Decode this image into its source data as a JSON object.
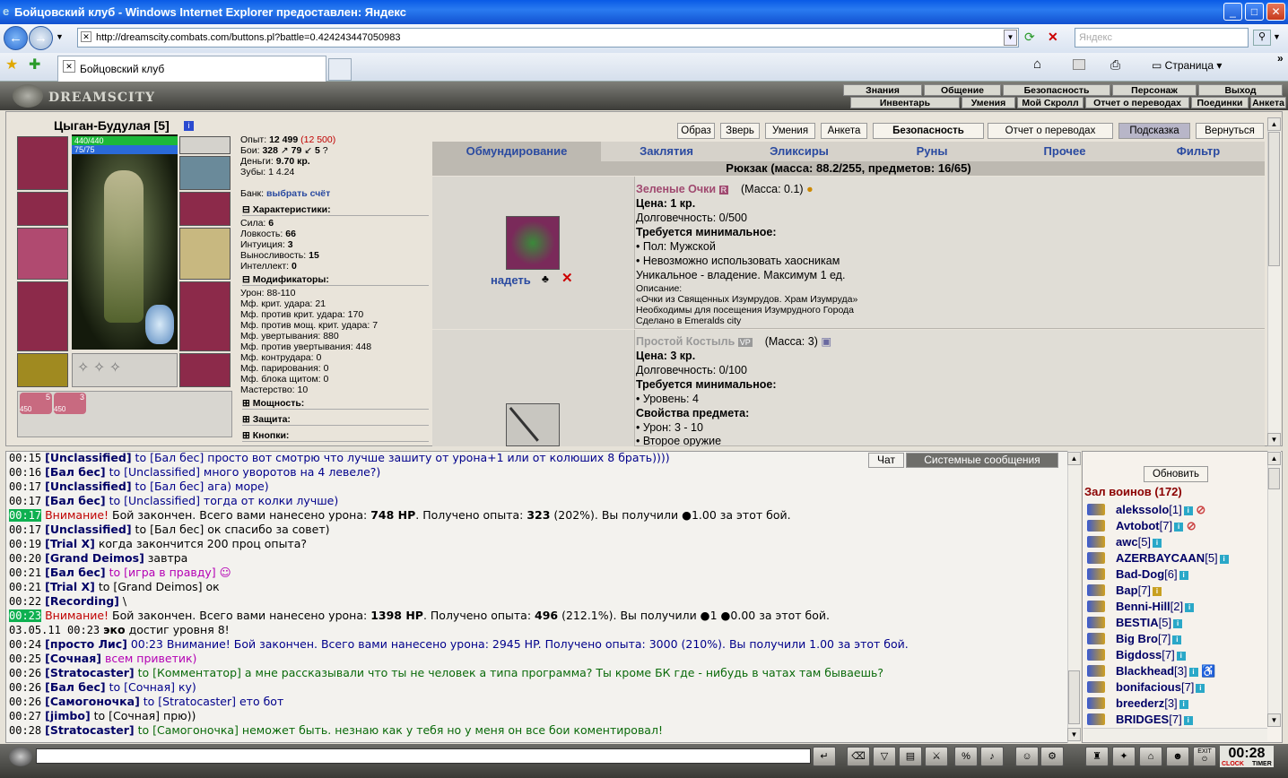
{
  "window": {
    "title": "Бойцовский клуб - Windows Internet Explorer предоставлен: Яндекс"
  },
  "browser": {
    "url": "http://dreamscity.combats.com/buttons.pl?battle=0.424243447050983",
    "search_placeholder": "Яндекс",
    "tab_title": "Бойцовский клуб",
    "page_menu": "Страница"
  },
  "game": {
    "logo": "DREAMSCITY",
    "nav_top": [
      "Знания",
      "Общение",
      "Безопасность",
      "Персонаж",
      "Выход"
    ],
    "nav_bottom": [
      "Инвентарь",
      "Умения",
      "Мой Скролл",
      "Отчет о переводах",
      "Поединки",
      "Анкета"
    ]
  },
  "character": {
    "name": "Цыган-Будулая [5]",
    "hp": "440/440",
    "mp": "75/75",
    "experience_label": "Опыт:",
    "experience": "12 499",
    "experience_next": "(12 500)",
    "fights_label": "Бои:",
    "wins": "328",
    "losses": "79",
    "draws": "5",
    "money_label": "Деньги:",
    "money": "9.70 кр.",
    "teeth_label": "Зубы:",
    "teeth": "1 4.24",
    "bank_label": "Банк:",
    "bank_link": "выбрать счёт",
    "belt_counts": [
      "5",
      "3"
    ],
    "belt_labels": [
      "450",
      "450"
    ],
    "characteristics_title": "Характеристики:",
    "stats": [
      {
        "label": "Сила:",
        "value": "6"
      },
      {
        "label": "Ловкость:",
        "value": "66"
      },
      {
        "label": "Интуиция:",
        "value": "3"
      },
      {
        "label": "Выносливость:",
        "value": "15"
      },
      {
        "label": "Интеллект:",
        "value": "0"
      }
    ],
    "modifiers_title": "Модификаторы:",
    "modifiers": [
      "Урон: 88-110",
      "Мф. крит. удара: 21",
      "Мф. против крит. удара: 170",
      "Мф. против мощ. крит. удара: 7",
      "Мф. увертывания: 880",
      "Мф. против увертывания: 448",
      "Мф. контрудара: 0",
      "Мф. парирования: 0",
      "Мф. блока щитом: 0",
      "Мастерство: 10"
    ],
    "sections_more": [
      "Мощность:",
      "Защита:",
      "Кнопки:"
    ]
  },
  "toolbar_buttons": [
    "Образ",
    "Зверь",
    "Умения",
    "Анкета",
    "Безопасность",
    "Отчет о переводах",
    "Подсказка",
    "Вернуться"
  ],
  "inventory": {
    "tabs": [
      "Обмундирование",
      "Заклятия",
      "Эликсиры",
      "Руны",
      "Прочее",
      "Фильтр"
    ],
    "backpack": "Рюкзак (масса: 88.2/255, предметов: 16/65)",
    "items": [
      {
        "name": "Зеленые Очки",
        "badge": "R",
        "mass": "(Масса: 0.1)",
        "action": "надеть",
        "price": "Цена: 1 кр.",
        "durability": "Долговечность: 0/500",
        "req_title": "Требуется минимальное:",
        "req": [
          "• Пол: Мужской",
          "• Невозможно использовать хаосникам"
        ],
        "unique": "Уникальное - владение. Максимум 1 ед.",
        "desc": [
          "Описание:",
          "«Очки из Священных Изумрудов. Храм Изумруда»",
          "Необходимы для посещения Изумрудного Города",
          "Сделано в Emeralds city"
        ]
      },
      {
        "name": "Простой Костыль",
        "badge": "VP",
        "mass": "(Масса: 3)",
        "price": "Цена: 3 кр.",
        "durability": "Долговечность: 0/100",
        "req_title": "Требуется минимальное:",
        "req": [
          "• Уровень: 4"
        ],
        "props_title": "Свойства предмета:",
        "props": [
          "• Урон: 3 - 10",
          "• Второе оружие"
        ]
      }
    ]
  },
  "chat": {
    "tabs": [
      "Чат",
      "Системные сообщения"
    ],
    "lines": [
      {
        "time": "00:15",
        "nick": "[Unclassified]",
        "to": " to [Бал бес]",
        "text": " просто вот смотрю что лучше зашиту от урона+1 или от колюших 8 брать))))",
        "style": "to"
      },
      {
        "time": "00:16",
        "nick": "[Бал бес]",
        "to": " to [Unclassified]",
        "text": " много уворотов на 4 левеле?)",
        "style": "to"
      },
      {
        "time": "00:17",
        "nick": "[Unclassified]",
        "to": " to [Бал бес]",
        "text": " ага) море)",
        "style": "to"
      },
      {
        "time": "00:17",
        "nick": "[Бал бес]",
        "to": " to [Unclassified]",
        "text": " тогда от колки лучше)",
        "style": "to"
      },
      {
        "time": "00:17",
        "sys": "Внимание!",
        "text": " Бой закончен. Всего вами нанесено урона: ",
        "b1": "748 HP",
        "t2": ". Получено опыта: ",
        "b2": "323",
        "t3": " (202%). Вы получили  ●1.00 за этот бой."
      },
      {
        "time": "00:17",
        "nick": "[Unclassified]",
        "to": " to [Бал бес]",
        "text": " ок спасибо за совет)",
        "style": "to"
      },
      {
        "time": "00:19",
        "nick": "[Trial X]",
        "to": "",
        "text": " когда закончится 200 проц опыта?",
        "style": "to"
      },
      {
        "time": "00:20",
        "nick": "[Grand Deimos]",
        "to": "",
        "text": " завтра",
        "style": "to"
      },
      {
        "time": "00:21",
        "nick": "[Бал бес]",
        "to": " to [игра в правду]",
        "text": "",
        "style": "pnk"
      },
      {
        "time": "00:21",
        "nick": "[Trial X]",
        "to": " to [Grand Deimos]",
        "text": " ок",
        "style": "to"
      },
      {
        "time": "00:22",
        "nick": "[Recording]",
        "to": "",
        "text": " \\",
        "style": "to"
      },
      {
        "time": "00:23",
        "sys": "Внимание!",
        "text": " Бой закончен. Всего вами нанесено урона: ",
        "b1": "1398 HP",
        "t2": ". Получено опыта: ",
        "b2": "496",
        "t3": " (212.1%). Вы получили  ●1 ●0.00 за этот бой."
      },
      {
        "time": "03.05.11 00:23",
        "nick": "эко",
        "to": "",
        "text": " достиг уровня 8!",
        "style": "plain"
      },
      {
        "time": "00:24",
        "nick": "[просто Лис]",
        "to": "",
        "text": " 00:23 Внимание! Бой закончен. Всего вами нанесено урона: 2945 HP. Получено опыта: 3000 (210%). Вы получили 1.00 за этот бой.",
        "style": "to"
      },
      {
        "time": "00:25",
        "nick": "[Сочная]",
        "to": "",
        "text": " всем приветик)",
        "style": "pnk"
      },
      {
        "time": "00:26",
        "nick": "[Stratocaster]",
        "to": " to [Комментатор]",
        "text": " а мне рассказывали что ты не человек а типа программа? Ты кроме БК где - нибудь в чатах там бываешь?",
        "style": "grn"
      },
      {
        "time": "00:26",
        "nick": "[Бал бес]",
        "to": " to [Сочная]",
        "text": " ку)",
        "style": "to"
      },
      {
        "time": "00:26",
        "nick": "[Самогоночка]",
        "to": " to [Stratocaster]",
        "text": " ето бот",
        "style": "to"
      },
      {
        "time": "00:27",
        "nick": "[jimbo]",
        "to": " to [Сочная]",
        "text": " прю))",
        "style": "plain"
      },
      {
        "time": "00:28",
        "nick": "[Stratocaster]",
        "to": " to [Самогоночка]",
        "text": " неможет быть. незнаю как у тебя но у меня он все бои коментировал!",
        "style": "grn"
      }
    ]
  },
  "players": {
    "refresh": "Обновить",
    "hall": "Зал воинов (172)",
    "list": [
      {
        "name": "alekssolo",
        "lvl": "[1]"
      },
      {
        "name": "Avtobot",
        "lvl": "[7]"
      },
      {
        "name": "awc",
        "lvl": "[5]"
      },
      {
        "name": "AZERBAYCAAN",
        "lvl": "[5]"
      },
      {
        "name": "Bad-Dog",
        "lvl": "[6]"
      },
      {
        "name": "Bap",
        "lvl": "[7]"
      },
      {
        "name": "Benni-Hill",
        "lvl": "[2]"
      },
      {
        "name": "BESTIA",
        "lvl": "[5]"
      },
      {
        "name": "Big Bro",
        "lvl": "[7]"
      },
      {
        "name": "Bigdoss",
        "lvl": "[7]"
      },
      {
        "name": "Blackhead",
        "lvl": "[3]"
      },
      {
        "name": "bonifacious",
        "lvl": "[7]"
      },
      {
        "name": "breederz",
        "lvl": "[3]"
      },
      {
        "name": "BRIDGES",
        "lvl": "[7]"
      }
    ]
  },
  "bottom": {
    "clock": "00:28",
    "clock_label": "CLOCK",
    "timer_label": "TIMER",
    "exit_label": "EXIT"
  }
}
